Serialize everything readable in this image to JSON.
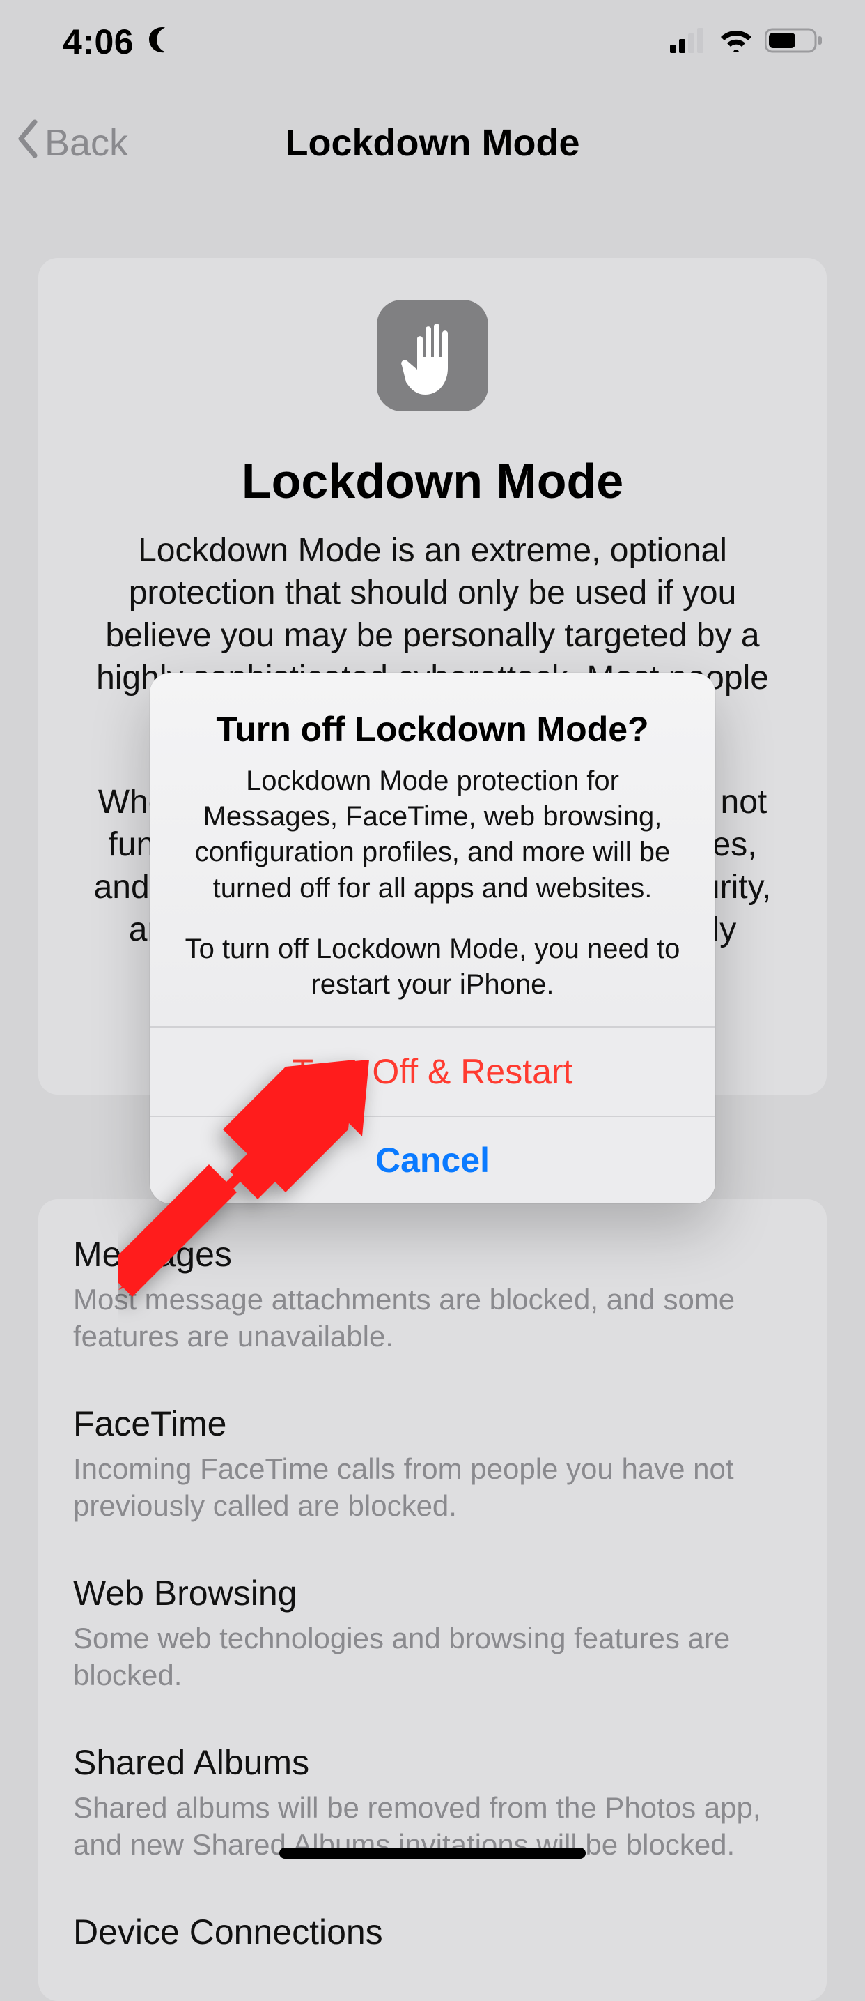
{
  "status": {
    "time": "4:06",
    "dnd_icon": "moon-icon"
  },
  "nav": {
    "back_label": "Back",
    "title": "Lockdown Mode"
  },
  "intro": {
    "title": "Lockdown Mode",
    "body1": "Lockdown Mode is an extreme, optional protection that should only be used if you believe you may be personally targeted by a highly sophisticated cyberattack. Most people are never",
    "body2": "When iPhone is in Lockdown Mode, it will not function as it typically does. Apps, websites, and features will be strictly limited for security, and some experiences will be completely unavailable."
  },
  "features": [
    {
      "title": "Messages",
      "body": "Most message attachments are blocked, and some features are unavailable."
    },
    {
      "title": "FaceTime",
      "body": "Incoming FaceTime calls from people you have not previously called are blocked."
    },
    {
      "title": "Web Browsing",
      "body": "Some web technologies and browsing features are blocked."
    },
    {
      "title": "Shared Albums",
      "body": "Shared albums will be removed from the Photos app, and new Shared Albums invitations will be blocked."
    },
    {
      "title": "Device Connections",
      "body": ""
    }
  ],
  "alert": {
    "title": "Turn off Lockdown Mode?",
    "message1": "Lockdown Mode protection for Messages, FaceTime, web browsing, configuration profiles, and more will be turned off for all apps and websites.",
    "message2": "To turn off Lockdown Mode, you need to restart your iPhone.",
    "turn_off_label": "Turn Off & Restart",
    "cancel_label": "Cancel"
  }
}
